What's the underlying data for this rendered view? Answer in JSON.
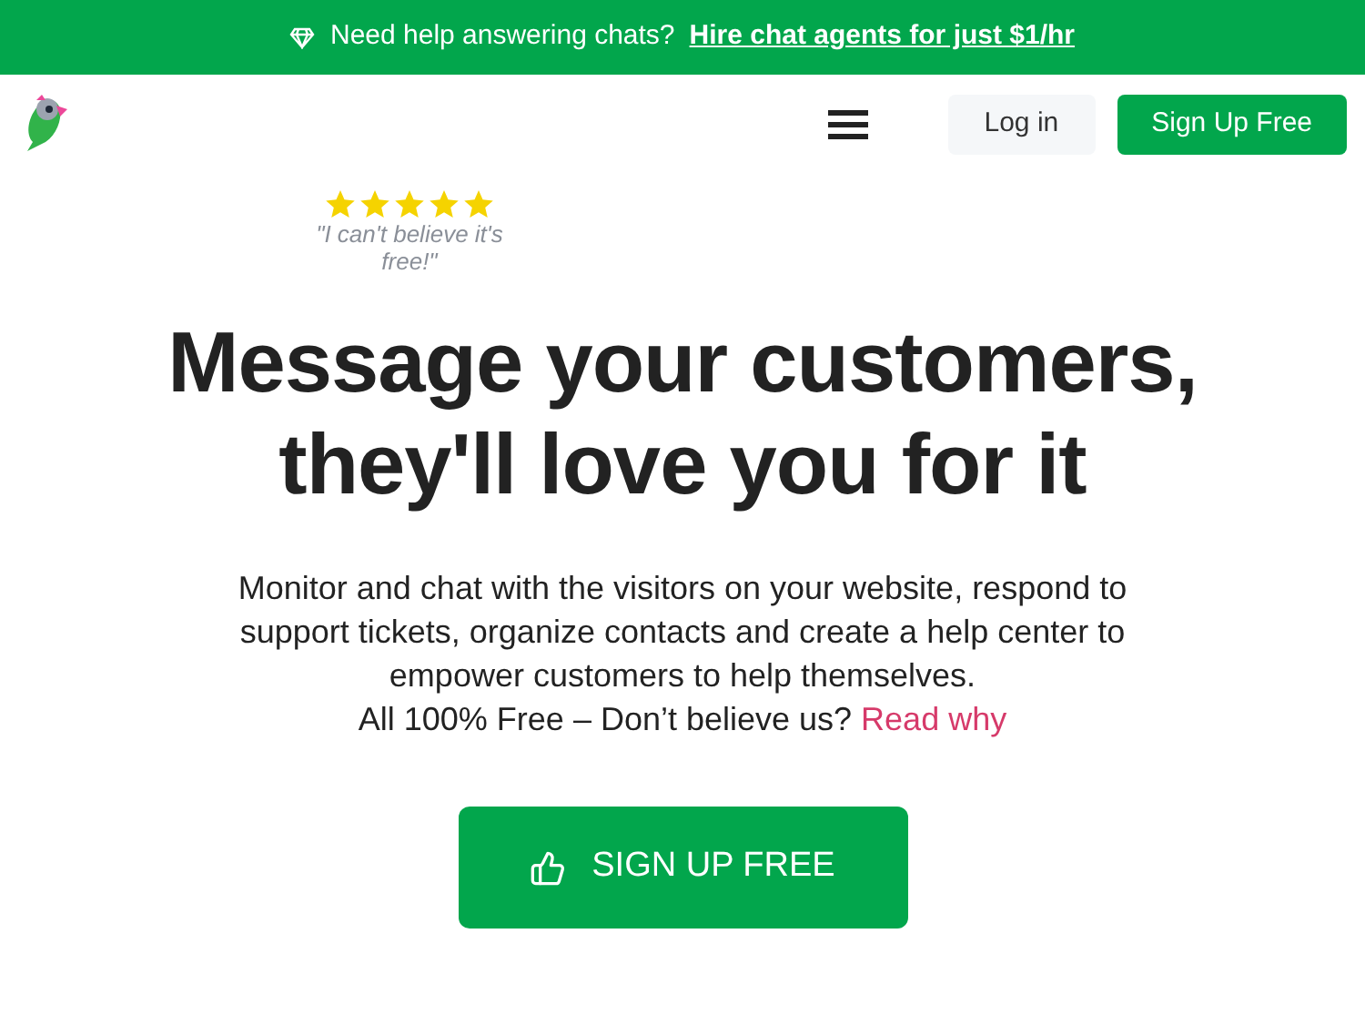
{
  "banner": {
    "text": "Need help answering chats?",
    "link": "Hire chat agents for just $1/hr"
  },
  "nav": {
    "login": "Log in",
    "signup": "Sign Up Free"
  },
  "testimonial": {
    "stars": 5,
    "quote": "\"I can't believe it's free!\""
  },
  "hero": {
    "headline": "Message your customers, they'll love you for it",
    "description": "Monitor and chat with the visitors on your website, respond to support tickets, organize contacts and create a help center to empower customers to help themselves.",
    "question": "All 100% Free – Don’t believe us?",
    "link": "Read why",
    "cta": "SIGN UP FREE"
  }
}
